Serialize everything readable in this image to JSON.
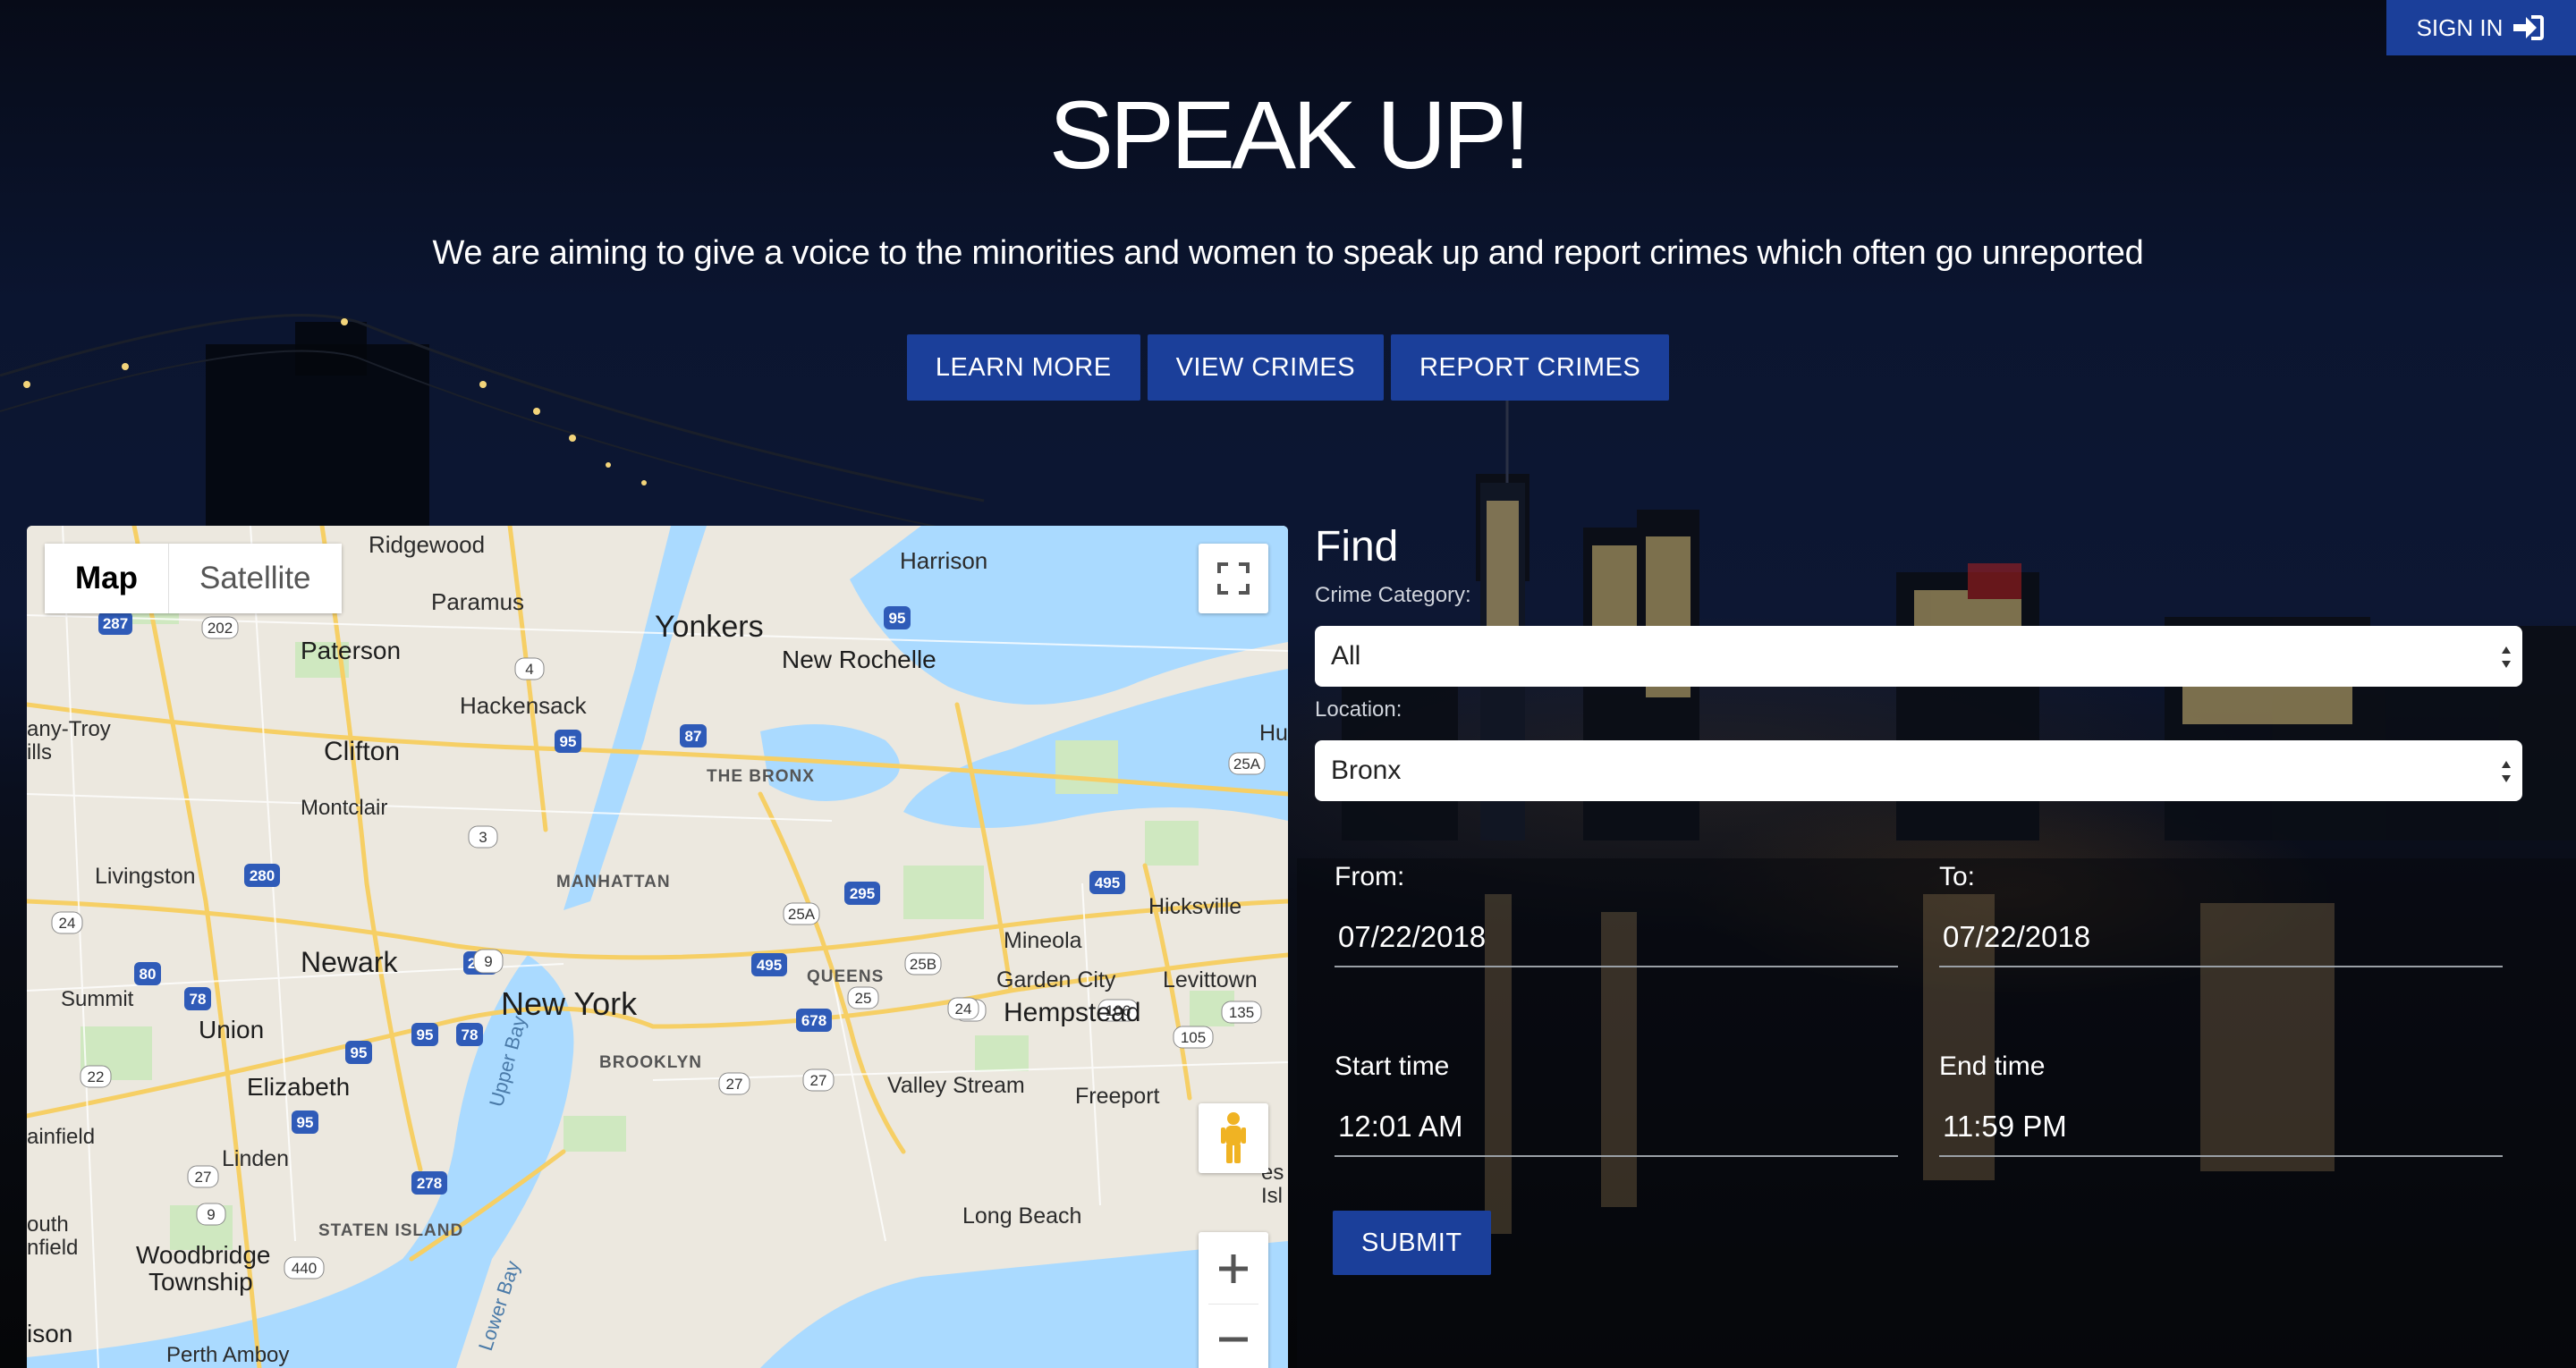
{
  "header": {
    "sign_in_label": "SIGN IN"
  },
  "hero": {
    "title": "SPEAK UP!",
    "subtitle": "We are aiming to give a voice to the minorities and women to speak up and report crimes which often go unreported",
    "buttons": [
      "LEARN MORE",
      "VIEW CRIMES",
      "REPORT CRIMES"
    ]
  },
  "map": {
    "type_buttons": {
      "map": "Map",
      "satellite": "Satellite"
    },
    "labels": {
      "ridgewood": "Ridgewood",
      "paramus": "Paramus",
      "harrison": "Harrison",
      "yonkers": "Yonkers",
      "new_rochelle": "New Rochelle",
      "paterson": "Paterson",
      "hackensack": "Hackensack",
      "clifton": "Clifton",
      "the_bronx": "THE BRONX",
      "montclair": "Montclair",
      "livingston": "Livingston",
      "manhattan": "MANHATTAN",
      "newark": "Newark",
      "new_york": "New York",
      "queens": "QUEENS",
      "mineola": "Mineola",
      "hicksville": "Hicksville",
      "garden_city": "Garden City",
      "levittown": "Levittown",
      "hempstead": "Hempstead",
      "summit": "Summit",
      "union": "Union",
      "brooklyn": "BROOKLYN",
      "elizabeth": "Elizabeth",
      "valley_stream": "Valley Stream",
      "freeport": "Freeport",
      "linden": "Linden",
      "staten_island": "STATEN ISLAND",
      "woodbridge": "Woodbridge",
      "township": "Township",
      "long_beach": "Long Beach",
      "perth_amboy": "Perth Amboy",
      "upper_bay": "Upper Bay",
      "lower_bay": "Lower Bay",
      "any_troy": "any-Troy",
      "ills": "ills",
      "ainfield": "ainfield",
      "outh": "outh",
      "nfield": "nfield",
      "ison": "ison",
      "hu": "Hu",
      "es": "es",
      "isl": "Isl"
    },
    "shields": [
      "287",
      "202",
      "4",
      "95",
      "80",
      "87",
      "95",
      "278",
      "25A",
      "3",
      "280",
      "495",
      "295",
      "25A",
      "95",
      "9",
      "495",
      "25B",
      "24",
      "78",
      "78",
      "678",
      "25",
      "24",
      "106",
      "135",
      "105",
      "95",
      "22",
      "27",
      "27",
      "95",
      "27",
      "9",
      "278",
      "440",
      "24"
    ]
  },
  "find": {
    "title": "Find",
    "crime_category_label": "Crime Category:",
    "crime_category_value": "All",
    "location_label": "Location:",
    "location_value": "Bronx",
    "from_label": "From:",
    "from_value": "07/22/2018",
    "to_label": "To:",
    "to_value": "07/22/2018",
    "start_time_label": "Start time",
    "start_time_value": "12:01 AM",
    "end_time_label": "End time",
    "end_time_value": "11:59 PM",
    "submit_label": "SUBMIT"
  },
  "colors": {
    "primary_button": "#1b3f9a",
    "background": "#0b1530",
    "map_water": "#aadaff"
  }
}
